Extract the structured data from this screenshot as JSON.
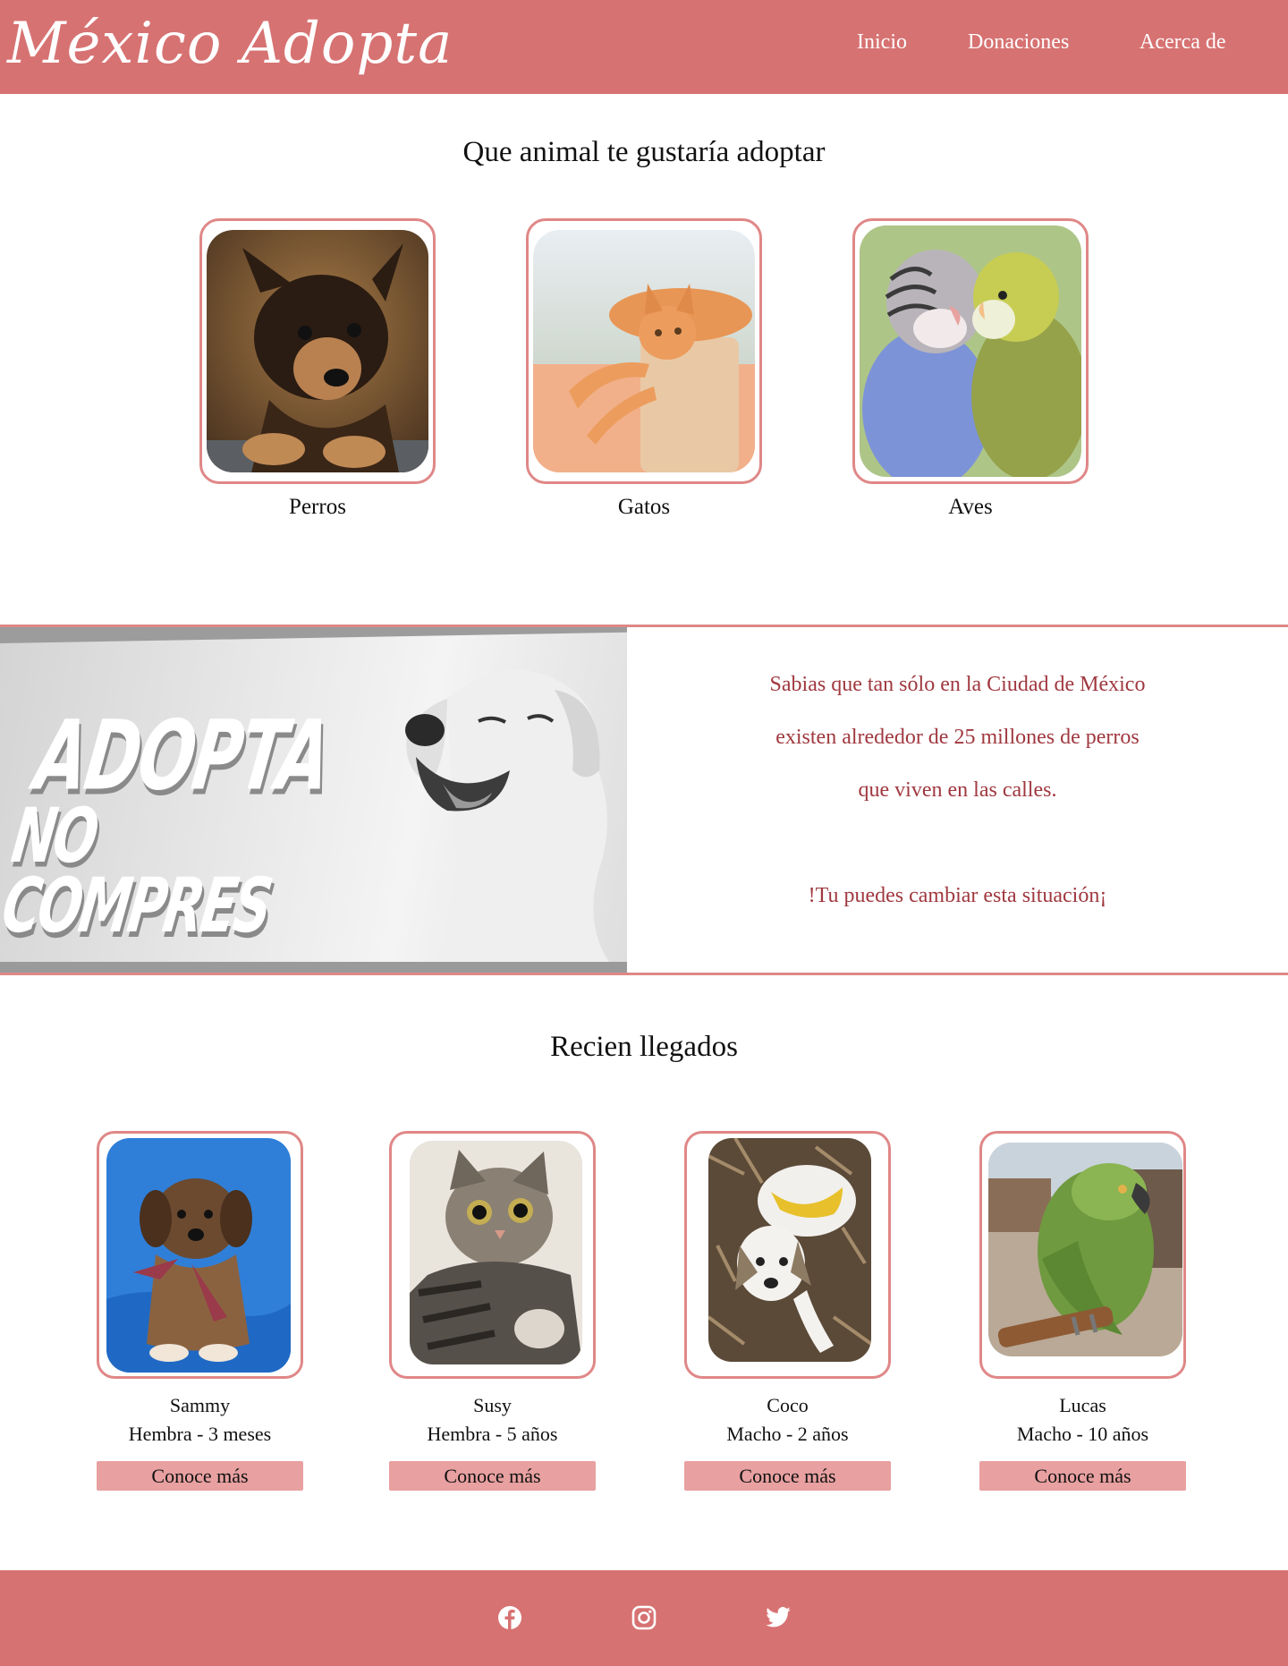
{
  "header": {
    "logo": "México Adopta",
    "nav": [
      "Inicio",
      "Donaciones",
      "Acerca de"
    ]
  },
  "categories": {
    "title": "Que animal te gustaría adoptar",
    "items": [
      {
        "label": "Perros",
        "image": "puppy-photo"
      },
      {
        "label": "Gatos",
        "image": "cat-photo"
      },
      {
        "label": "Aves",
        "image": "parakeets-photo"
      }
    ]
  },
  "banner": {
    "image_line1": "ADOPTA",
    "image_line2": "NO COMPRES",
    "lines": [
      "Sabias que tan sólo en la Ciudad de México",
      "existen alrededor de 25 millones de perros",
      "que viven en las calles.",
      "!Tu puedes cambiar esta situación¡"
    ]
  },
  "recent": {
    "title": "Recien llegados",
    "button_label": "Conoce más",
    "pets": [
      {
        "name": "Sammy",
        "info": "Hembra - 3 meses"
      },
      {
        "name": "Susy",
        "info": "Hembra - 5 años"
      },
      {
        "name": "Coco",
        "info": "Macho - 2 años"
      },
      {
        "name": "Lucas",
        "info": "Macho - 10 años"
      }
    ]
  },
  "footer": {
    "icons": [
      "facebook-icon",
      "instagram-icon",
      "twitter-icon"
    ]
  },
  "colors": {
    "brand": "#d77272",
    "card_border": "#e08787",
    "button": "#e8a0a0",
    "banner_text": "#a0383f"
  }
}
